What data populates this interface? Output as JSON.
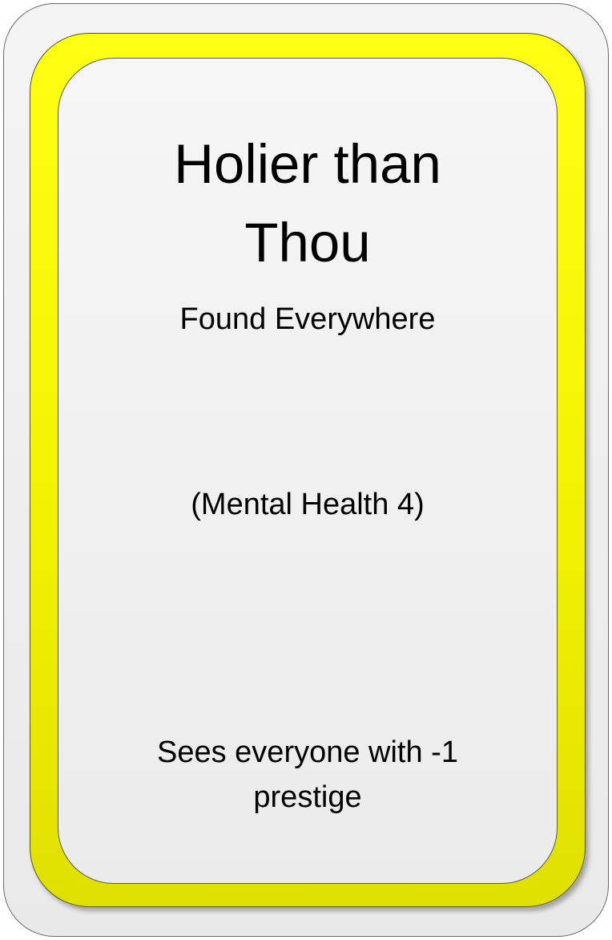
{
  "card": {
    "title": "Holier than Thou",
    "subtitle": "Found Everywhere",
    "stat": "(Mental Health 4)",
    "effect": "Sees everyone with -1 prestige"
  },
  "colors": {
    "frame": "#f2f200",
    "face": "#ececec",
    "outline": "#5a5a5a"
  }
}
